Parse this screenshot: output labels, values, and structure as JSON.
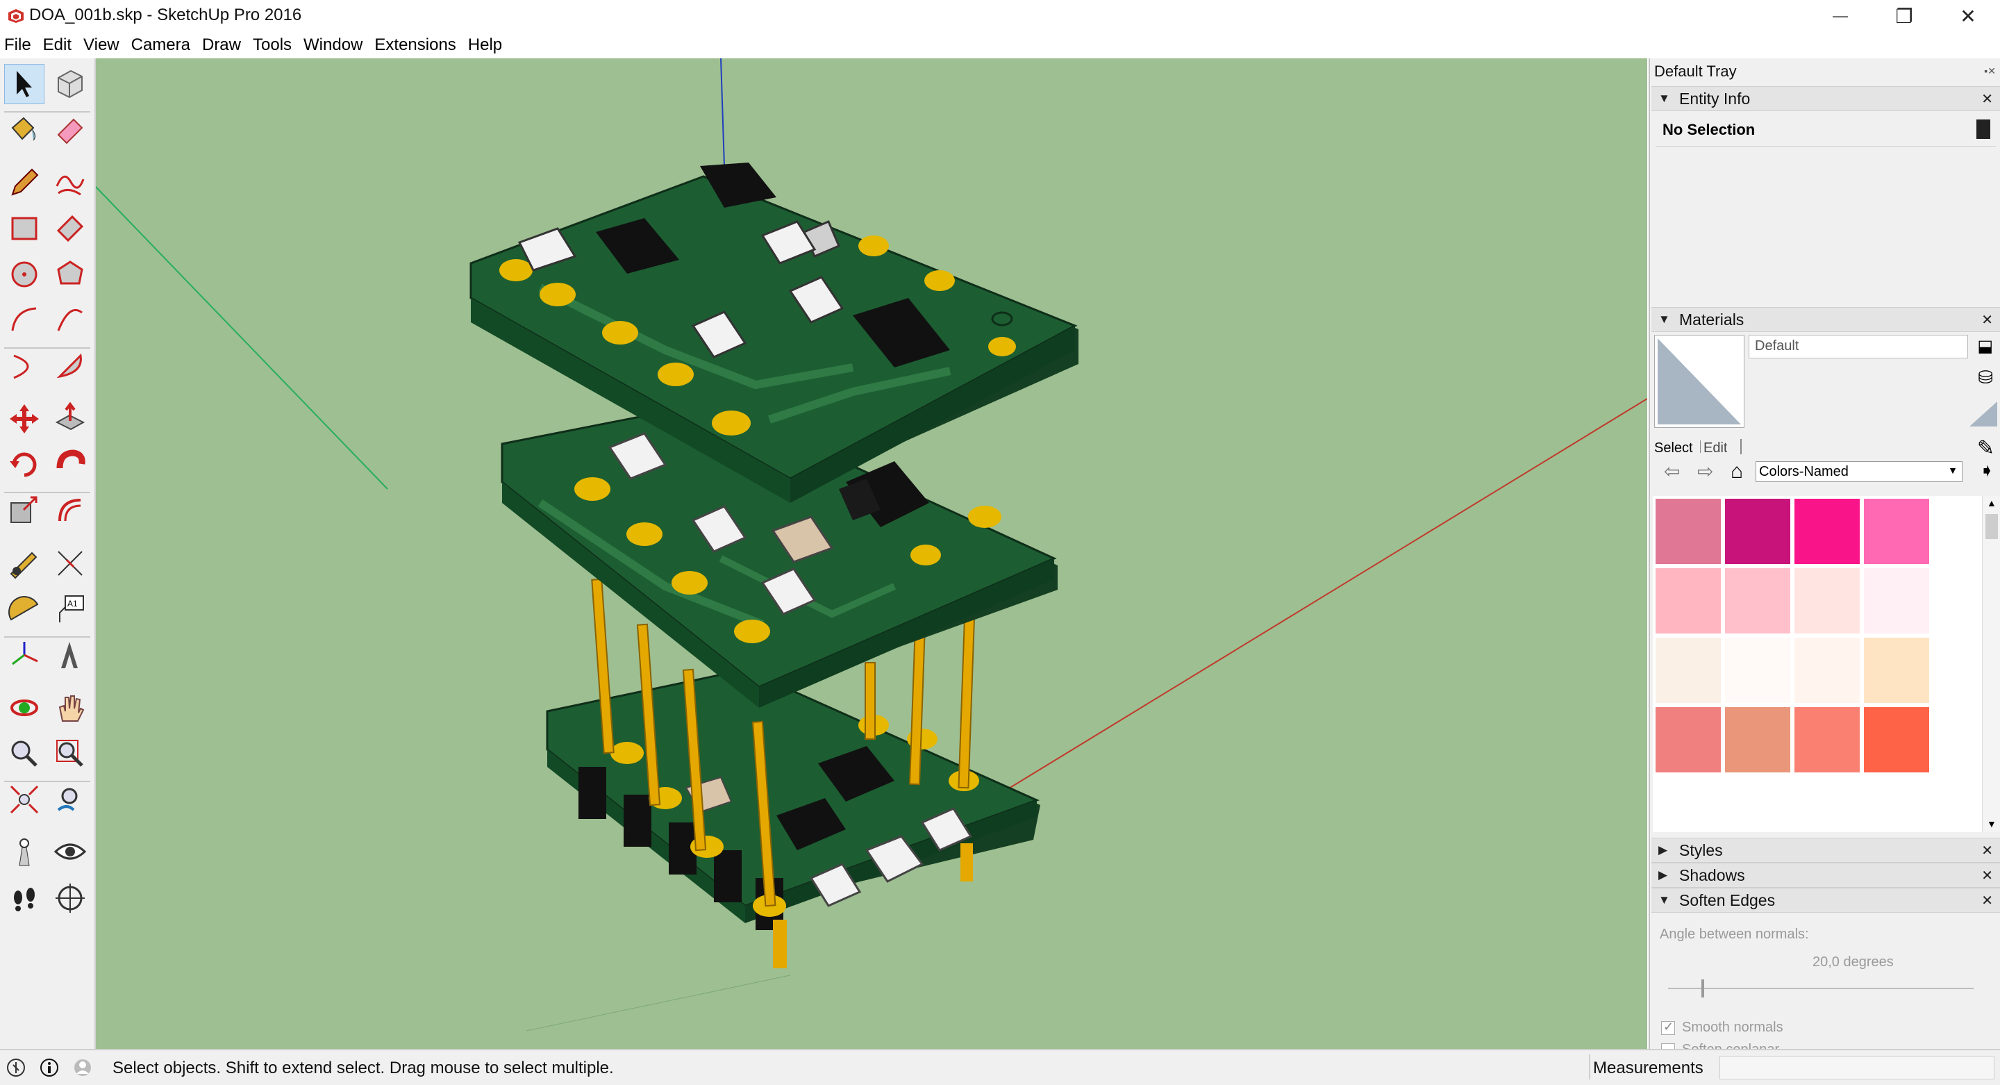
{
  "window": {
    "title": "DOA_001b.skp - SketchUp Pro 2016",
    "minimize_glyph": "—",
    "restore_glyph": "❐",
    "close_glyph": "✕"
  },
  "menu": [
    "File",
    "Edit",
    "View",
    "Camera",
    "Draw",
    "Tools",
    "Window",
    "Extensions",
    "Help"
  ],
  "tools": [
    "select-arrow-icon",
    "make-component-icon",
    "paint-bucket-icon",
    "eraser-icon",
    "line-pencil-icon",
    "freehand-icon",
    "rectangle-icon",
    "rotated-rectangle-icon",
    "circle-icon",
    "polygon-icon",
    "arc-icon",
    "two-point-arc-icon",
    "three-point-arc-icon",
    "pie-icon",
    "move-icon",
    "push-pull-icon",
    "rotate-icon",
    "follow-me-icon",
    "scale-icon",
    "offset-icon",
    "tape-measure-icon",
    "dimension-icon",
    "protractor-icon",
    "text-icon",
    "axes-icon",
    "3d-text-icon",
    "orbit-icon",
    "pan-hand-icon",
    "zoom-icon",
    "zoom-window-icon",
    "zoom-extents-icon",
    "previous-view-icon",
    "position-camera-icon",
    "look-around-icon",
    "walk-icon",
    "section-plane-icon"
  ],
  "tray": {
    "title": "Default Tray",
    "entity_info": {
      "title": "Entity Info",
      "selection": "No Selection"
    },
    "materials": {
      "title": "Materials",
      "current_name": "Default",
      "tab_select": "Select",
      "tab_edit": "Edit",
      "library": "Colors-Named",
      "swatches": [
        "#e07794",
        "#c8147a",
        "#fa1489",
        "#ff69b4",
        "#ffb6c1",
        "#ffc0cb",
        "#ffe4e1",
        "#fff0f5",
        "#faf0e6",
        "#fffaf7",
        "#fff5ee",
        "#ffe4c4",
        "#f08080",
        "#e9967a",
        "#fa8072",
        "#ff6347"
      ]
    },
    "styles": {
      "title": "Styles"
    },
    "shadows": {
      "title": "Shadows"
    },
    "soften_edges": {
      "title": "Soften Edges",
      "angle_label": "Angle between normals:",
      "angle_value": "20,0  degrees",
      "smooth_normals": "Smooth normals",
      "soften_coplanar": "Soften coplanar",
      "smooth_normals_checked": true,
      "soften_coplanar_checked": false,
      "slider_fraction": 0.11
    }
  },
  "status": {
    "hint": "Select objects. Shift to extend select. Drag mouse to select multiple.",
    "measurements_label": "Measurements"
  },
  "colors": {
    "viewport_bg": "#9ebf91",
    "pcb_green": "#1c5e32",
    "pad_gold": "#e6b800",
    "pin_gold": "#e5a800",
    "axis_red": "#c0392b",
    "axis_green": "#27ae60",
    "axis_blue": "#1f3fbf"
  }
}
